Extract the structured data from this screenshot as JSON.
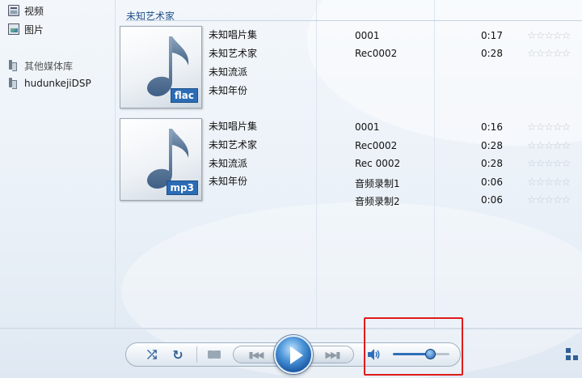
{
  "sidebar": {
    "items": [
      {
        "label": "视频",
        "icon": "video-icon"
      },
      {
        "label": "图片",
        "icon": "picture-icon"
      },
      {
        "label": "其他媒体库",
        "icon": "library-icon"
      },
      {
        "label": "hudunkejiDSP",
        "icon": "library-icon"
      }
    ]
  },
  "artist_group": {
    "name": "未知艺术家"
  },
  "albums": [
    {
      "format": "flac",
      "meta": [
        "未知唱片集",
        "未知艺术家",
        "未知流派",
        "未知年份"
      ],
      "tracks": [
        {
          "title": "0001",
          "duration": "0:17",
          "rating": 0
        },
        {
          "title": "Rec0002",
          "duration": "0:28",
          "rating": 0
        }
      ]
    },
    {
      "format": "mp3",
      "meta": [
        "未知唱片集",
        "未知艺术家",
        "未知流派",
        "未知年份"
      ],
      "tracks": [
        {
          "title": "0001",
          "duration": "0:16",
          "rating": 0
        },
        {
          "title": "Rec0002",
          "duration": "0:28",
          "rating": 0
        },
        {
          "title": "Rec 0002",
          "duration": "0:28",
          "rating": 0
        },
        {
          "title": "音频录制1",
          "duration": "0:06",
          "rating": 0
        },
        {
          "title": "音频录制2",
          "duration": "0:06",
          "rating": 0
        }
      ]
    }
  ],
  "controls": {
    "volume_fraction": 0.66,
    "accent_color": "#2f6fb8",
    "highlight_color": "#e01b1b"
  }
}
